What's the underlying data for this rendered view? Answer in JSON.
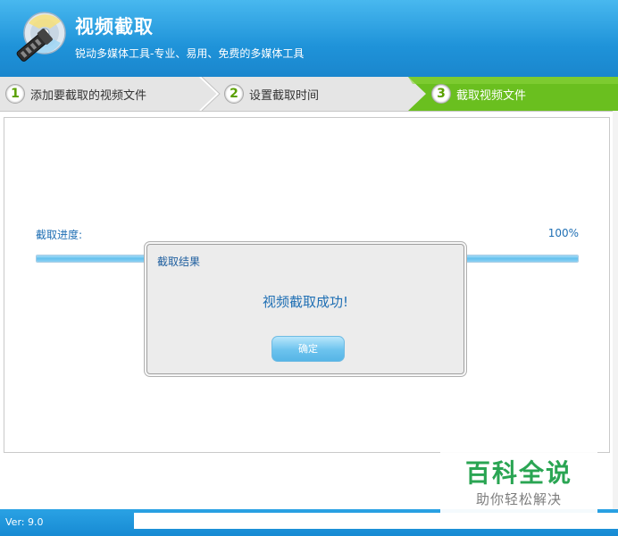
{
  "header": {
    "title": "视频截取",
    "subtitle": "锐动多媒体工具-专业、易用、免费的多媒体工具"
  },
  "steps": [
    {
      "number": "1",
      "label": "添加要截取的视频文件"
    },
    {
      "number": "2",
      "label": "设置截取时间"
    },
    {
      "number": "3",
      "label": "截取视频文件"
    }
  ],
  "progress": {
    "label": "截取进度:",
    "percent_text": "100%",
    "value": 100
  },
  "dialog": {
    "title": "截取结果",
    "message": "视频截取成功!",
    "ok_label": "确定"
  },
  "footer": {
    "version": "Ver: 9.0"
  },
  "watermark": {
    "main": "百科全说",
    "sub": "助你轻松解决"
  },
  "colors": {
    "header_blue": "#1f93d9",
    "active_step_green": "#6abf1f",
    "text_blue": "#1f6fb4"
  }
}
